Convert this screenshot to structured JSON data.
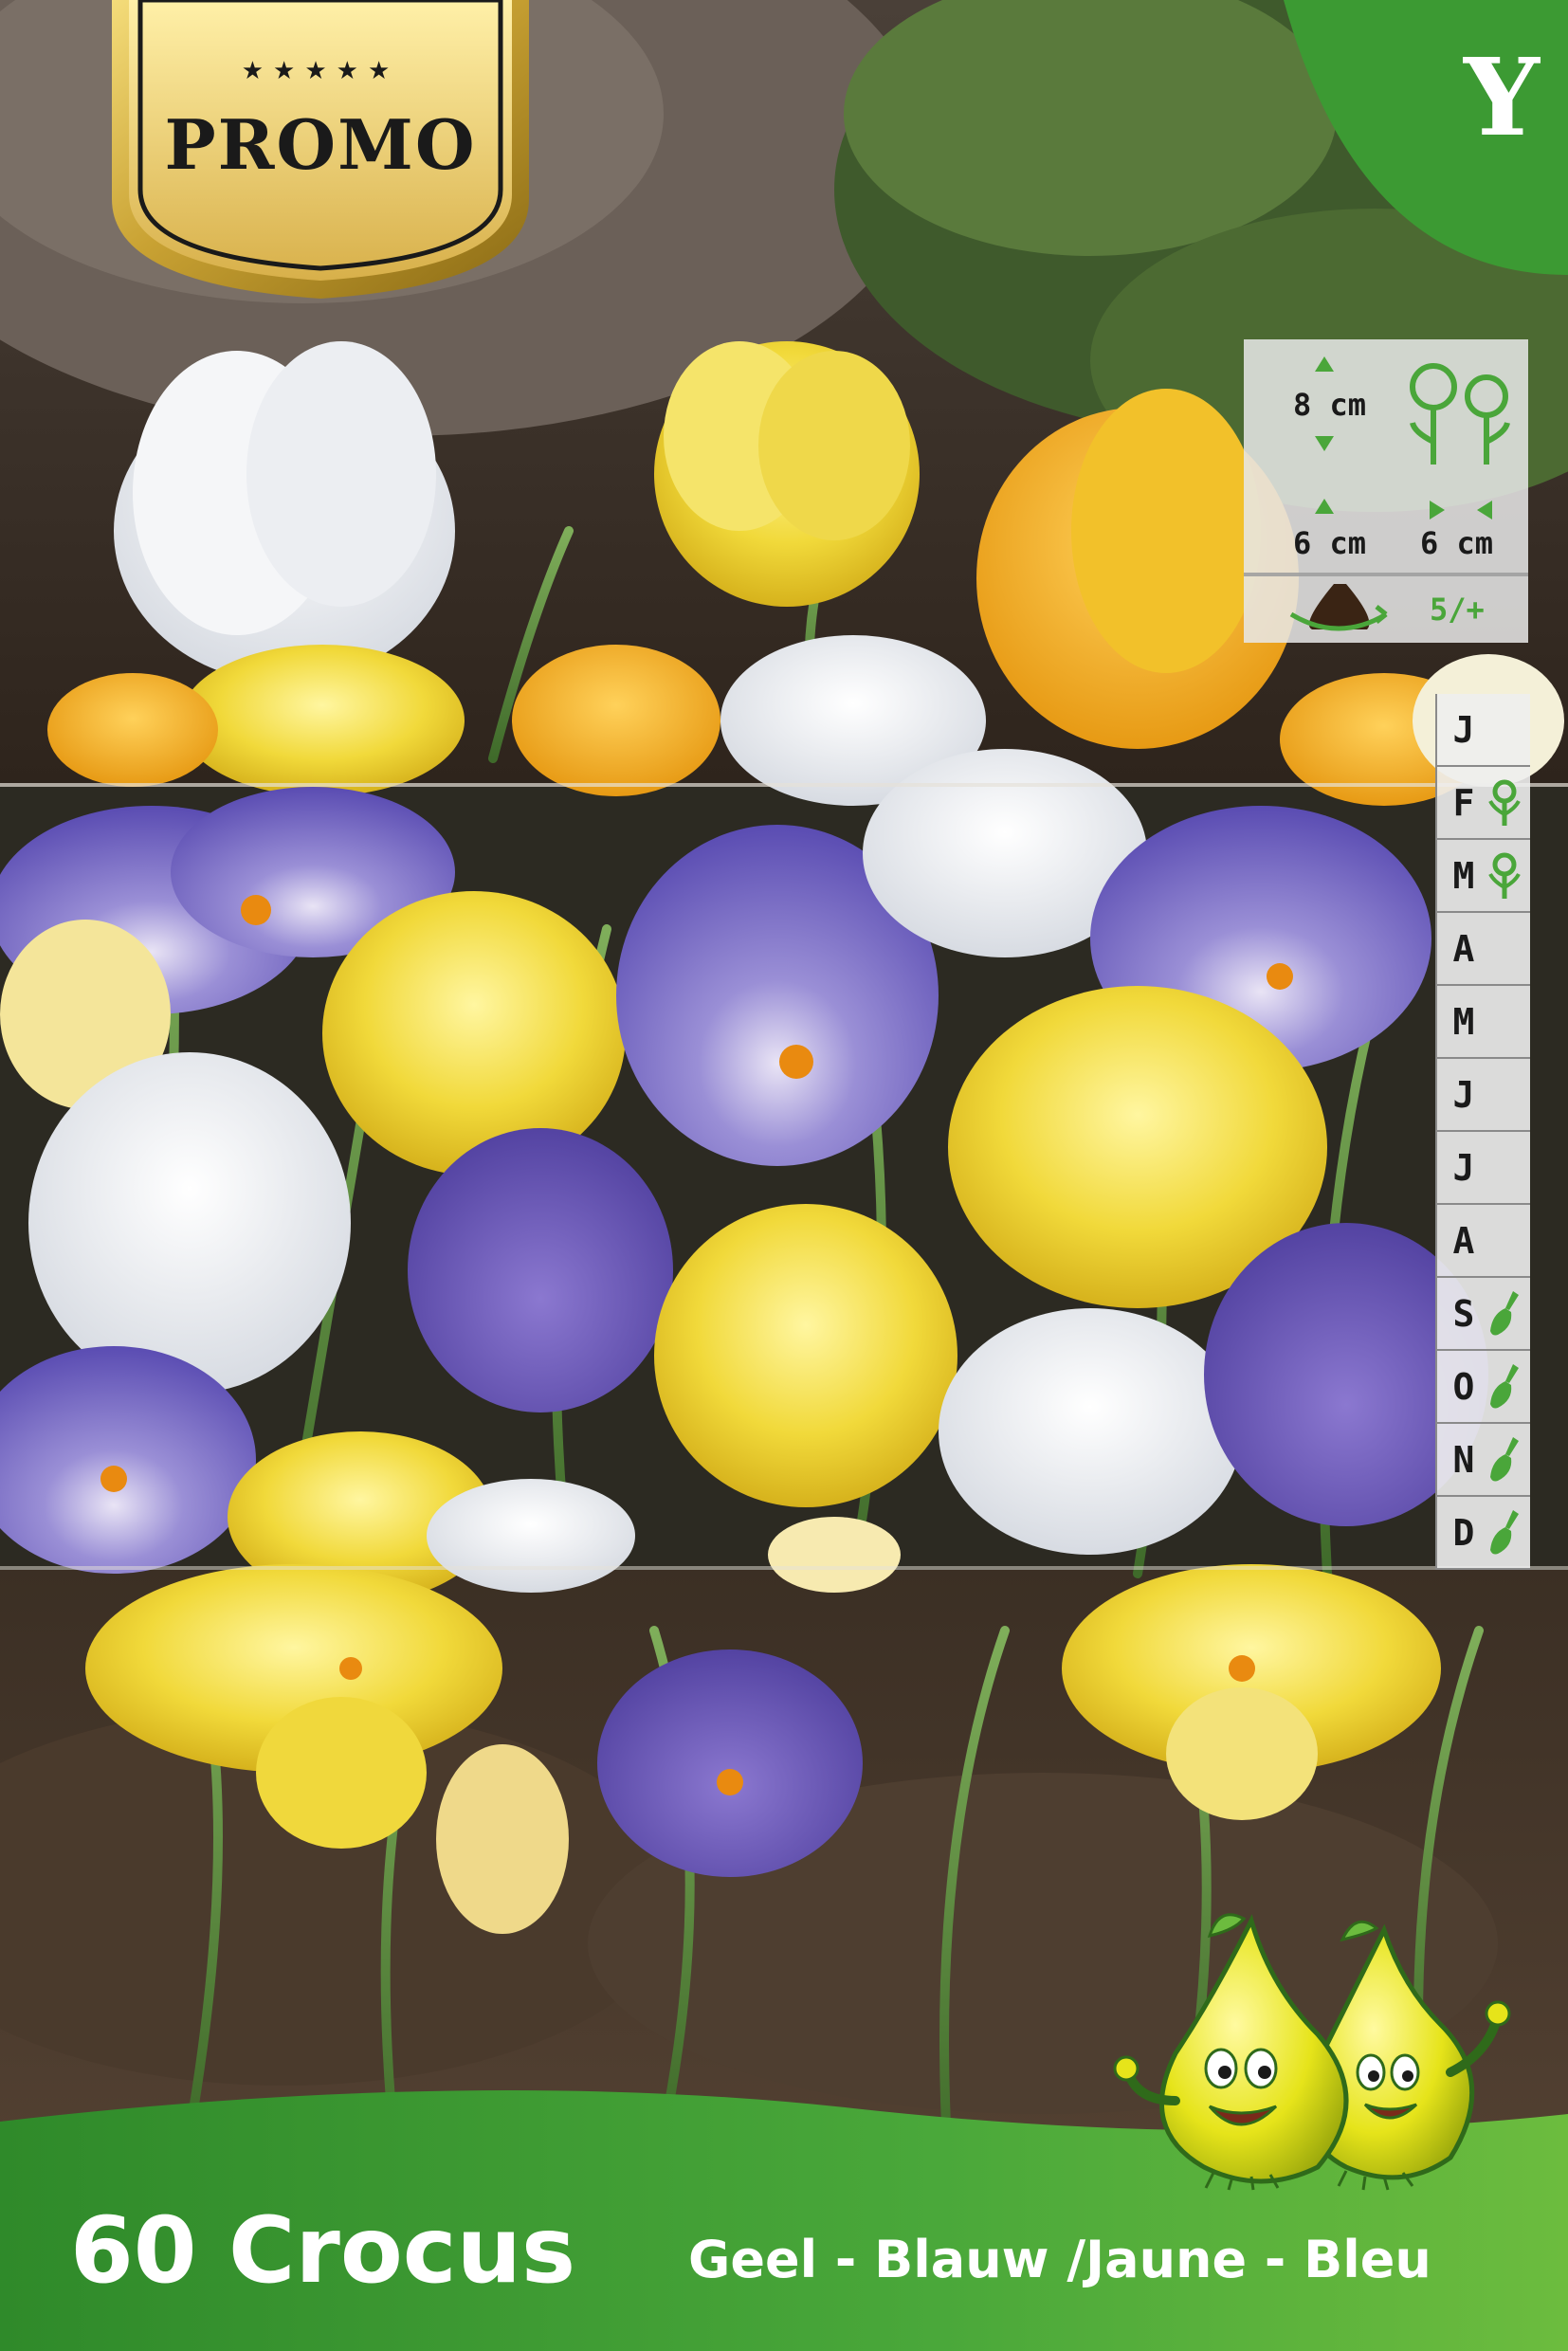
{
  "badge": {
    "stars": "★★★★★",
    "label": "PROMO",
    "gold": "#c9a233"
  },
  "zone": {
    "letter": "Y",
    "color": "#3c9a33"
  },
  "planting": {
    "depth": "8 cm",
    "height_spacing": "6 cm",
    "plant_spacing": "6 cm",
    "bulb_size": "5/+",
    "icon_color": "#4aa63a"
  },
  "calendar": {
    "months": [
      {
        "letter": "J",
        "icon": ""
      },
      {
        "letter": "F",
        "icon": "flower-icon"
      },
      {
        "letter": "M",
        "icon": "flower-icon"
      },
      {
        "letter": "A",
        "icon": ""
      },
      {
        "letter": "M",
        "icon": ""
      },
      {
        "letter": "J",
        "icon": ""
      },
      {
        "letter": "J",
        "icon": ""
      },
      {
        "letter": "A",
        "icon": ""
      },
      {
        "letter": "S",
        "icon": "trowel-icon"
      },
      {
        "letter": "O",
        "icon": "trowel-icon"
      },
      {
        "letter": "N",
        "icon": "trowel-icon"
      },
      {
        "letter": "D",
        "icon": "trowel-icon"
      }
    ]
  },
  "product": {
    "title": "60 Crocus",
    "subtitle": "Geel - Blauw /Jaune - Bleu",
    "banner_color": "#3f9a2f"
  }
}
